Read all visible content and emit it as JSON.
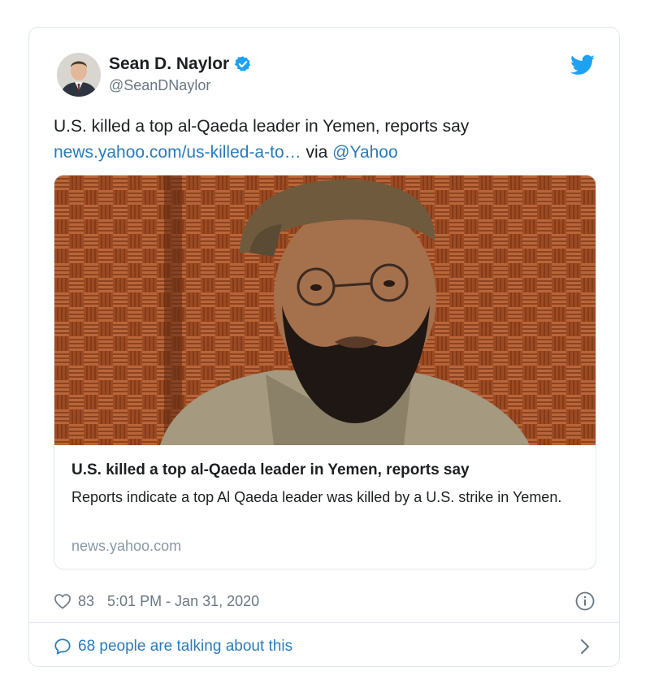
{
  "author": {
    "name": "Sean D. Naylor",
    "handle": "@SeanDNaylor",
    "avatar_icon": "profile-photo",
    "verified_icon": "verified-badge-icon"
  },
  "brand": {
    "logo_icon": "twitter-bird-icon",
    "accent_color": "#1da1f2",
    "link_color": "#2b7bb9"
  },
  "tweet": {
    "text": "U.S. killed a top al-Qaeda leader in Yemen, reports say",
    "link_text": "news.yahoo.com/us-killed-a-to…",
    "via_label": "via",
    "mention": "@Yahoo"
  },
  "card": {
    "image_icon": "news-photo",
    "title": "U.S. killed a top al-Qaeda leader in Yemen, reports say",
    "description": "Reports indicate a top Al Qaeda leader was killed by a U.S. strike in Yemen.",
    "domain": "news.yahoo.com"
  },
  "footer": {
    "like_icon": "heart-icon",
    "like_count": "83",
    "timestamp": "5:01 PM - Jan 31, 2020",
    "info_icon": "info-icon"
  },
  "conversation": {
    "bubble_icon": "speech-bubble-icon",
    "label": "68 people are talking about this",
    "chevron_icon": "chevron-right-icon"
  }
}
